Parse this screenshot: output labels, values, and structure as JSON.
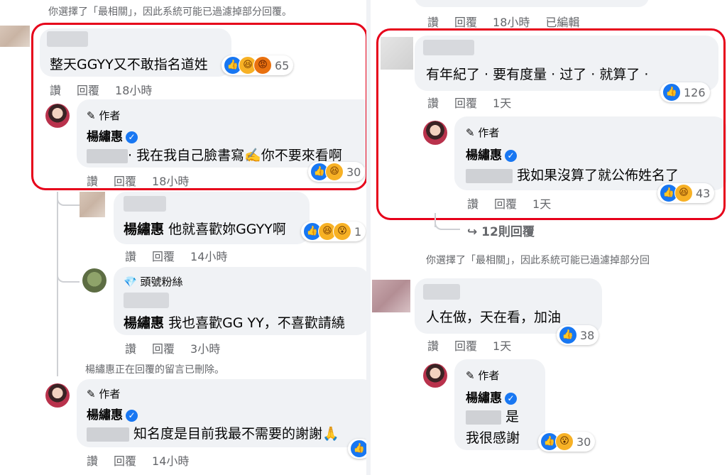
{
  "common": {
    "filter_notice": "你選擇了「最相關」，因此系統可能已過濾掉部分回覆。",
    "filter_notice_cut": "你選擇了「最相關」，因此系統可能已過濾掉部分回",
    "like_label": "讚",
    "reply_label": "回覆",
    "author_tag": "作者",
    "top_fan_tag": "頭號粉絲",
    "author_name": "楊繡惠",
    "edited_label": "已編輯"
  },
  "left": {
    "c1": {
      "text": "整天GGYY又不敢指名道姓",
      "time": "18小時",
      "reactions": "65"
    },
    "r1": {
      "text": "· 我在我自己臉書寫✍️你不要來看啊",
      "time": "18小時",
      "reactions": "30"
    },
    "r2": {
      "mention": "楊繡惠",
      "text": "他就喜歡妳GGYY啊",
      "time": "14小時",
      "reactions": "1"
    },
    "r3": {
      "mention": "楊繡惠",
      "text": "我也喜歡GG YY，不喜歡請繞",
      "time": "3小時"
    },
    "deleted_notice": "楊繡惠正在回覆的留言已刪除。",
    "r4": {
      "text": "知名度是目前我最不需要的謝謝🙏",
      "time": "14小時"
    }
  },
  "right": {
    "top_actions_time": "18小時",
    "c1": {
      "text": "有年紀了 · 要有度量 · 过了 · 就算了 ·",
      "time": "1天",
      "reactions": "126"
    },
    "r1": {
      "text": "我如果沒算了就公佈姓名了",
      "time": "1天",
      "reactions": "43"
    },
    "more_replies": "12則回覆",
    "c2": {
      "text": "人在做，天在看，加油",
      "time": "1天",
      "reactions": "38"
    },
    "r2": {
      "line1": "是",
      "line2": "我很感謝",
      "reactions": "30"
    }
  }
}
